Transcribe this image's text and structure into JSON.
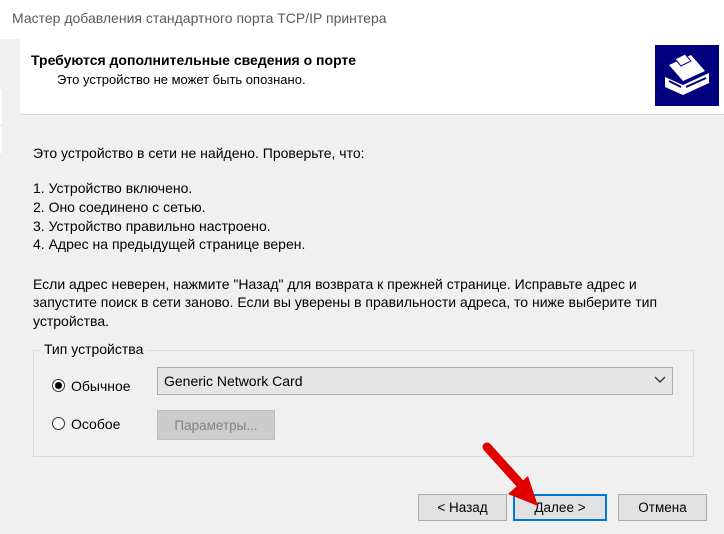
{
  "window": {
    "title": "Мастер добавления стандартного порта TCP/IP принтера"
  },
  "header": {
    "title": "Требуются дополнительные сведения о порте",
    "subtitle": "Это устройство не может быть опознано."
  },
  "body": {
    "intro": "Это устройство в сети не найдено. Проверьте, что:",
    "checks": [
      "1.  Устройство включено.",
      "2.  Оно соединено с сетью.",
      "3.  Устройство правильно настроено.",
      "4.  Адрес на предыдущей странице верен."
    ],
    "advice_lines": [
      "Если адрес неверен, нажмите \"Назад\" для возврата к прежней странице.  Исправьте адрес и",
      "запустите поиск в сети заново.  Если вы уверены в правильности адреса, то ниже выберите тип",
      "устройства."
    ]
  },
  "device_type": {
    "legend": "Тип устройства",
    "standard_label": "Обычное",
    "standard_checked": true,
    "standard_value": "Generic Network Card",
    "custom_label": "Особое",
    "custom_checked": false,
    "settings_button": "Параметры..."
  },
  "footer": {
    "back_button": "< Назад",
    "next_button": "Далее >",
    "cancel_button": "Отмена"
  },
  "colors": {
    "icon_blue": "#00007f",
    "accent": "#0078d7",
    "pointer_arrow": "#e00000"
  },
  "icons": {
    "wizard": "printer-icon",
    "dropdown": "chevron-down-icon",
    "pointer": "red-arrow-icon"
  }
}
